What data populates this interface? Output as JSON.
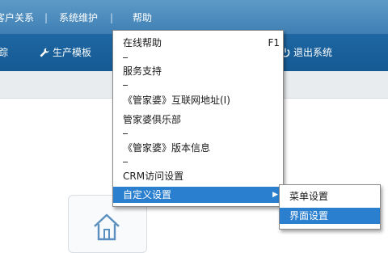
{
  "topbar": {
    "items": [
      "客户关系",
      "系统维护",
      "帮助"
    ]
  },
  "toolbar": {
    "left_fragment": "踪",
    "production_template": "生产模板",
    "logout": "退出系统"
  },
  "help_menu": {
    "items": [
      {
        "label": "在线帮助",
        "shortcut": "F1"
      },
      {
        "label": "服务支持"
      },
      {
        "label": "《管家婆》互联网地址(I)"
      },
      {
        "label": "管家婆俱乐部"
      },
      {
        "label": "《管家婆》版本信息"
      },
      {
        "label": "CRM访问设置"
      },
      {
        "label": "自定义设置",
        "submenu_arrow": "▶"
      }
    ],
    "separator": "-"
  },
  "submenu": {
    "items": [
      "菜单设置",
      "界面设置"
    ]
  },
  "icons": {
    "wrench": "wrench-icon",
    "power": "power-icon",
    "home": "home-icon"
  },
  "colors": {
    "menu_highlight": "#2b7fcf",
    "toolbar": "#1e67a3",
    "topbar": "#4d8dbf"
  }
}
